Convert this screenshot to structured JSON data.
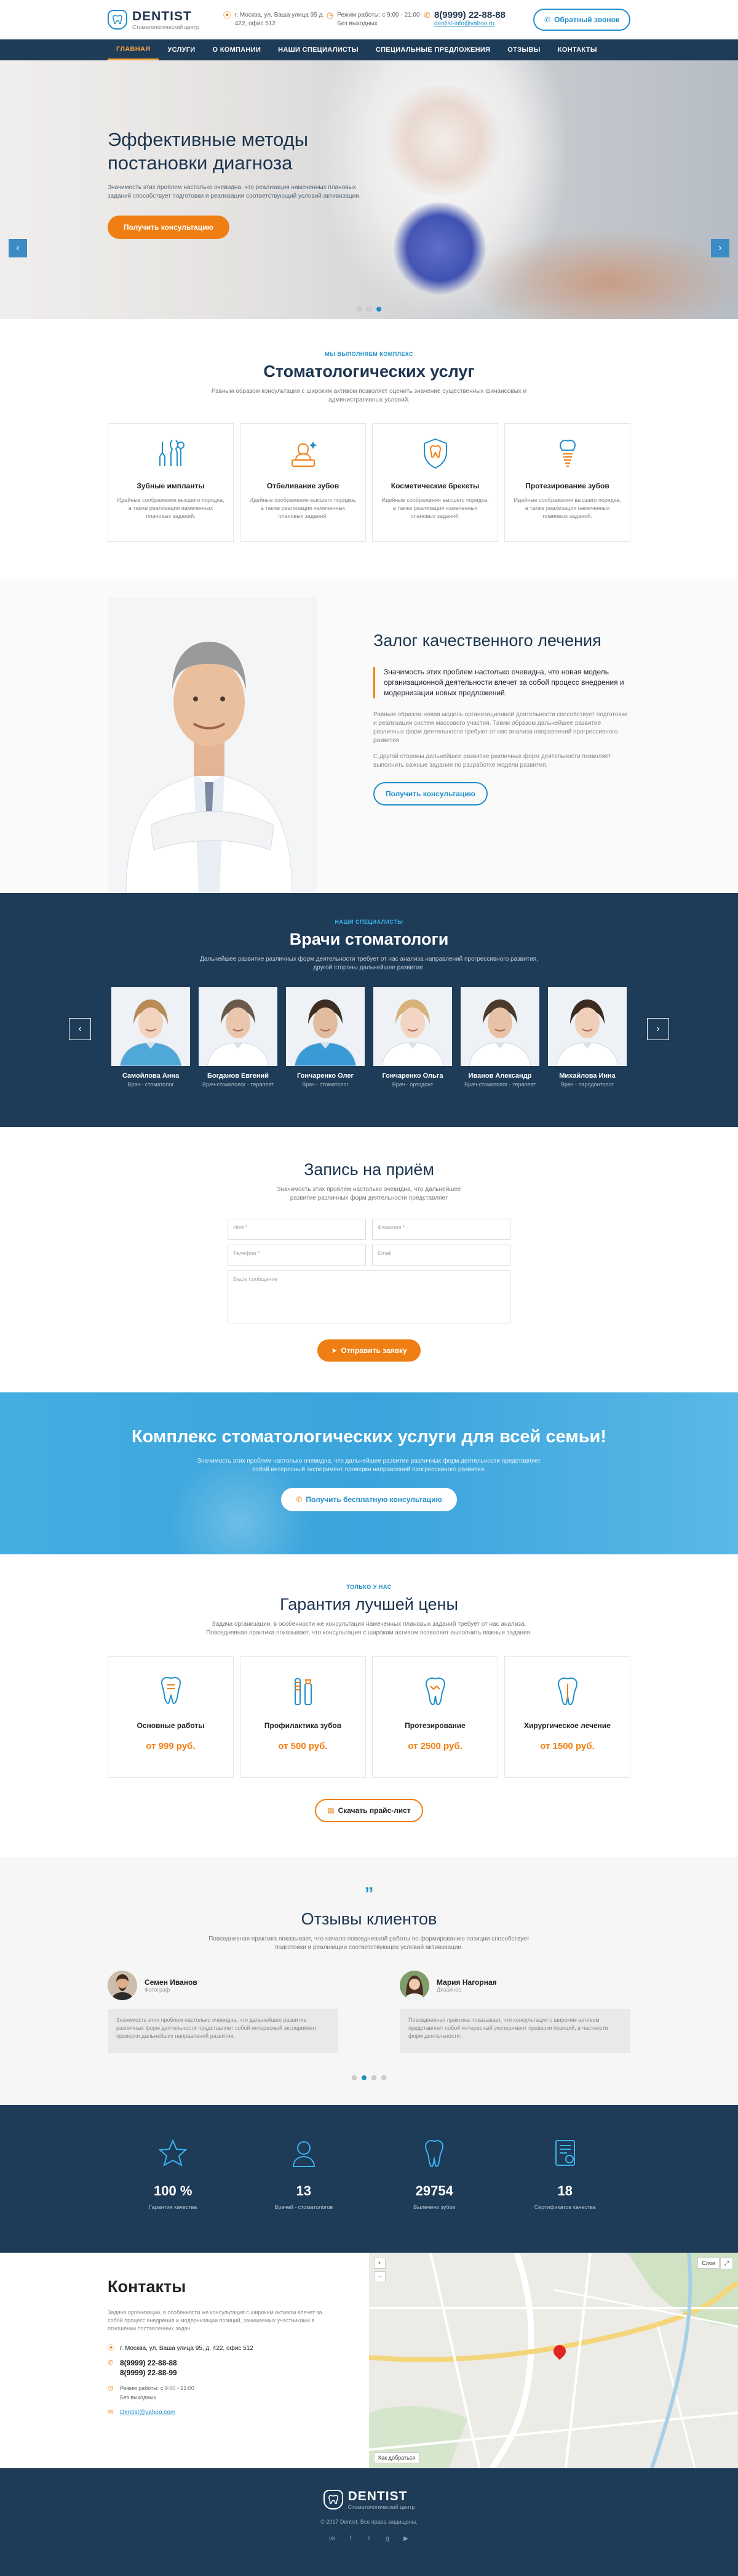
{
  "header": {
    "logo_title": "DENTIST",
    "logo_sub": "Стоматологический центр",
    "address": "г. Москва, ул. Ваша улица 95 д. 422, офис 512",
    "hours_label": "Режим работы: с 9:00 - 21:00",
    "hours_sub": "Без выходных",
    "phone": "8(9999) 22-88-88",
    "email": "dentist-info@yahoo.ru",
    "callback": "Обратный звонок"
  },
  "nav": [
    "ГЛАВНАЯ",
    "УСЛУГИ",
    "О КОМПАНИИ",
    "НАШИ СПЕЦИАЛИСТЫ",
    "СПЕЦИАЛЬНЫЕ ПРЕДЛОЖЕНИЯ",
    "ОТЗЫВЫ",
    "КОНТАКТЫ"
  ],
  "hero": {
    "title": "Эффективные методы постановки диагноза",
    "text": "Значимость этих проблем настолько очевидна, что реализация намеченных плановых заданий способствует подготовки и реализации соответствующий условий активизации.",
    "button": "Получить консультацию",
    "arrow_left": "‹",
    "arrow_right": "›"
  },
  "services": {
    "kicker": "МЫ ВЫПОЛНЯЕМ КОМПЛЕКС",
    "title": "Стоматологических услуг",
    "desc": "Равным образом консультация с широким активом позволяет оценить значение существенных финансовых и административных условий.",
    "items": [
      {
        "title": "Зубные импланты",
        "text": "Идейные соображения высшего порядка, а также реализация намеченных плановых заданий."
      },
      {
        "title": "Отбеливание зубов",
        "text": "Идейные соображения высшего порядка, а также реализация намеченных плановых заданий."
      },
      {
        "title": "Косметические брекеты",
        "text": "Идейные соображения высшего порядка, а также реализация намеченных плановых заданий."
      },
      {
        "title": "Протезирование зубов",
        "text": "Идейные соображения высшего порядка, а также реализация намеченных плановых заданий."
      }
    ]
  },
  "quality": {
    "title": "Залог качественного лечения",
    "quote": "Значимость этих проблем настолько очевидна, что новая модель организационной деятельности влечет за собой процесс внедрения и модернизации новых предложений.",
    "p1": "Равным образом новая модель организационной деятельности способствует подготовки и реализации систем массового участия. Таким образом дальнейшее развитие различных форм деятельности требуют от нас анализа направлений прогрессивного развития.",
    "p2": "С другой стороны дальнейшее развитие различных форм деятельности позволяет выполнить важные задания по разработке модели развития.",
    "button": "Получить консультацию"
  },
  "doctors": {
    "kicker": "НАШИ СПЕЦИАЛИСТЫ",
    "title": "Врачи стоматологи",
    "desc": "Дальнейшее развитие различных форм деятельности требует от нас анализа направлений прогрессивного развития, другой стороны дальнейшее развитие.",
    "arrow_left": "‹",
    "arrow_right": "›",
    "items": [
      {
        "name": "Самойлова Анна",
        "role": "Врач - стоматолог",
        "skin": "#f1d3be",
        "hair": "#b98b55",
        "coat": "#4fa8d8"
      },
      {
        "name": "Богданов Евгений",
        "role": "Врач-стоматолог - терапевт",
        "skin": "#eac6ad",
        "hair": "#6b5a4c",
        "coat": "#ffffff"
      },
      {
        "name": "Гончаренко Олег",
        "role": "Врач - стоматолог",
        "skin": "#e2bc9f",
        "hair": "#3d2d22",
        "coat": "#3a9ad5"
      },
      {
        "name": "Гончаренко Ольга",
        "role": "Врач - ортодонт",
        "skin": "#f2d5c2",
        "hair": "#d7b27a",
        "coat": "#ffffff"
      },
      {
        "name": "Иванов Александр",
        "role": "Врач-стоматолог - терапевт",
        "skin": "#e7c2a6",
        "hair": "#4a3a2e",
        "coat": "#ffffff"
      },
      {
        "name": "Михайлова Инна",
        "role": "Врач - пародонтолог",
        "skin": "#efcfb9",
        "hair": "#3b2a1f",
        "coat": "#ffffff"
      }
    ]
  },
  "appointment": {
    "title": "Запись на приём",
    "desc": "Значимость этих проблем настолько очевидна, что дальнейшее развитие различных форм деятельности представляет",
    "name_ph": "Имя *",
    "phone_ph": "Телефон *",
    "surname_ph": "Фамилия *",
    "email_ph": "Email",
    "message_ph": "Ваше сообщение",
    "button": "Отправить заявку"
  },
  "family": {
    "title": "Комплекс стоматологических услуги для всей семьи!",
    "text": "Значимость этих проблем настолько очевидна, что дальнейшее развитие различных форм деятельности представляет собой интересный эксперимент проверки направлений прогрессивного развития.",
    "button": "Получить бесплатную консультацию"
  },
  "prices": {
    "kicker": "ТОЛЬКО У НАС",
    "title": "Гарантия лучшей цены",
    "desc": "Задача организации, в особенности же консультация намеченных плановых заданий требует от нас анализа. Повседневная практика показывает, что консультация с широким активом позволяет выполнить важные задания.",
    "items": [
      {
        "title": "Основные работы",
        "price": "от 999 руб."
      },
      {
        "title": "Профилактика зубов",
        "price": "от 500 руб."
      },
      {
        "title": "Протезирование",
        "price": "от 2500 руб."
      },
      {
        "title": "Хирургическое лечение",
        "price": "от 1500 руб."
      }
    ],
    "button": "Скачать прайс-лист"
  },
  "reviews": {
    "quote_mark": "”",
    "title": "Отзывы клиентов",
    "desc": "Повседневная практика показывает, что начало повседневной работы по формированию позиции способствует подготовки и реализации соответствующих условий активизации.",
    "items": [
      {
        "name": "Семен Иванов",
        "sub": "Фотограф",
        "text": "Значимость этих проблем настолько очевидна, что дальнейшее развитие различных форм деятельности представляет собой интересный эксперимент проверки дальнейших направлений развития."
      },
      {
        "name": "Мария Нагорная",
        "sub": "Дизайнер",
        "text": "Повседневная практика показывает, что консультация с широким активом представляет собой интересный эксперимент проверки позиций, в частности форм деятельности."
      }
    ]
  },
  "stats": [
    {
      "num": "100 %",
      "label": "Гарантия качества",
      "icon": "star-icon"
    },
    {
      "num": "13",
      "label": "Врачей - стоматологов",
      "icon": "user-icon"
    },
    {
      "num": "29754",
      "label": "Вылечено зубов",
      "icon": "tooth-icon"
    },
    {
      "num": "18",
      "label": "Сертификатов качества",
      "icon": "certificate-icon"
    }
  ],
  "contacts": {
    "title": "Контакты",
    "text": "Задача организации, в особенности же консультация с широким активом влечет за собой процесс внедрения и модернизации позиций, занимаемых участниками в отношении поставленных задач.",
    "address": "г. Москва, ул. Ваша улица 95, д. 422, офис 512",
    "phone1": "8(9999) 22-88-88",
    "phone2": "8(9999) 22-88-99",
    "hours": "Режим работы: с 9:00 - 21:00",
    "hours_sub": "Без выходных",
    "email": "Dentist@yahoo.com",
    "map_zoom_in": "+",
    "map_zoom_out": "−",
    "map_layers": "Слои",
    "map_fullscreen": "⤢",
    "map_attribution": "Как добраться"
  },
  "footer": {
    "logo_title": "DENTIST",
    "logo_sub": "Стоматологический центр",
    "copy": "© 2017 Dentist. Все права защищены.",
    "socials": [
      "vk",
      "f",
      "t",
      "g",
      "▶"
    ]
  },
  "colors": {
    "accent": "#f07f13",
    "brand": "#1f8fc8",
    "navy": "#1e3b57"
  }
}
